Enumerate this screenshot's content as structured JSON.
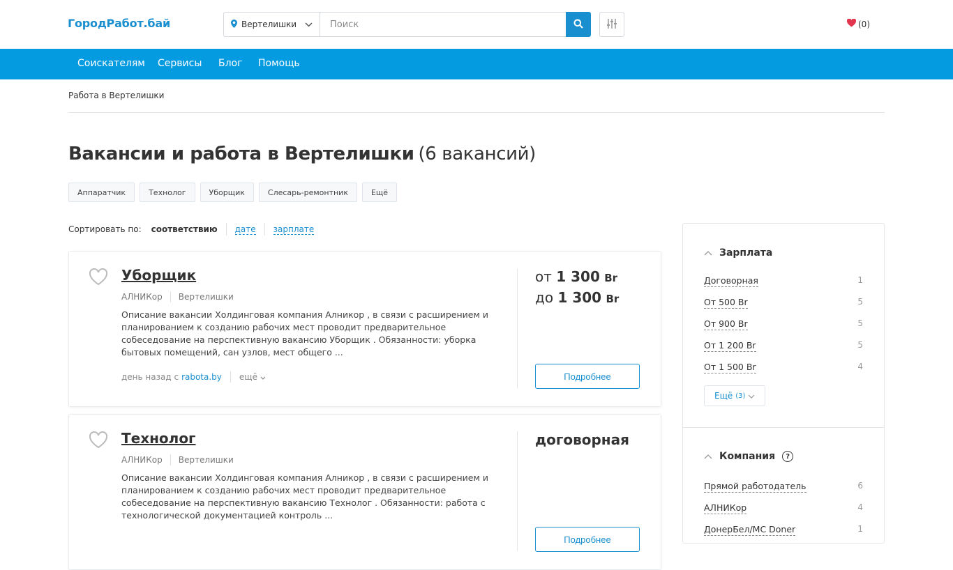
{
  "header": {
    "logo": "ГородРабот.бай",
    "location": "Вертелишки",
    "search_placeholder": "Поиск",
    "favorites_count": "(0)"
  },
  "nav": {
    "items": [
      "Соискателям",
      "Сервисы",
      "Блог",
      "Помощь"
    ]
  },
  "breadcrumb": "Работа в Вертелишки",
  "page": {
    "title": "Вакансии и работа в Вертелишки",
    "count": "(6 вакансий)"
  },
  "tags": [
    "Аппаратчик",
    "Технолог",
    "Уборщик",
    "Слесарь-ремонтник",
    "Ещё"
  ],
  "sort": {
    "label": "Сортировать по:",
    "active": "соответствию",
    "options": [
      "дате",
      "зарплате"
    ]
  },
  "vacancies": [
    {
      "title": "Уборщик",
      "company": "АЛНИКор",
      "city": "Вертелишки",
      "description": "Описание вакансии Холдинговая компания Алникор , в связи с расширением и планированием к созданию рабочих мест проводит предварительное собеседование на перспективную вакансию Уборщик . Обязанности: уборка бытовых помещений, сан узлов, мест общего ...",
      "posted": "день назад с",
      "source": "rabota.by",
      "more": "ещё",
      "salary_from_prefix": "от",
      "salary_from": "1 300",
      "salary_to_prefix": "до",
      "salary_to": "1 300",
      "currency": "Br",
      "button": "Подробнее"
    },
    {
      "title": "Технолог",
      "company": "АЛНИКор",
      "city": "Вертелишки",
      "description": "Описание вакансии Холдинговая компания Алникор , в связи с расширением и планированием к созданию рабочих мест проводит предварительное собеседование на перспективную вакансию Технолог . Обязанности: работа с технологической документацией контроль ...",
      "salary_text": "договорная",
      "button": "Подробнее"
    }
  ],
  "sidebar": {
    "salary": {
      "title": "Зарплата",
      "items": [
        {
          "label": "Договорная",
          "count": "1"
        },
        {
          "label": "От 500 Br",
          "count": "5"
        },
        {
          "label": "От 900 Br",
          "count": "5"
        },
        {
          "label": "От 1 200 Br",
          "count": "5"
        },
        {
          "label": "От 1 500 Br",
          "count": "4"
        }
      ],
      "more_label": "Ещё",
      "more_count": "(3)"
    },
    "company": {
      "title": "Компания",
      "items": [
        {
          "label": "Прямой работодатель",
          "count": "6"
        },
        {
          "label": "АЛНИКор",
          "count": "4"
        },
        {
          "label": "ДонерБел/MC Doner",
          "count": "1"
        }
      ]
    }
  },
  "colors": {
    "brand": "#059be1",
    "link": "#1a8fd0",
    "favorite": "#e2364f"
  }
}
